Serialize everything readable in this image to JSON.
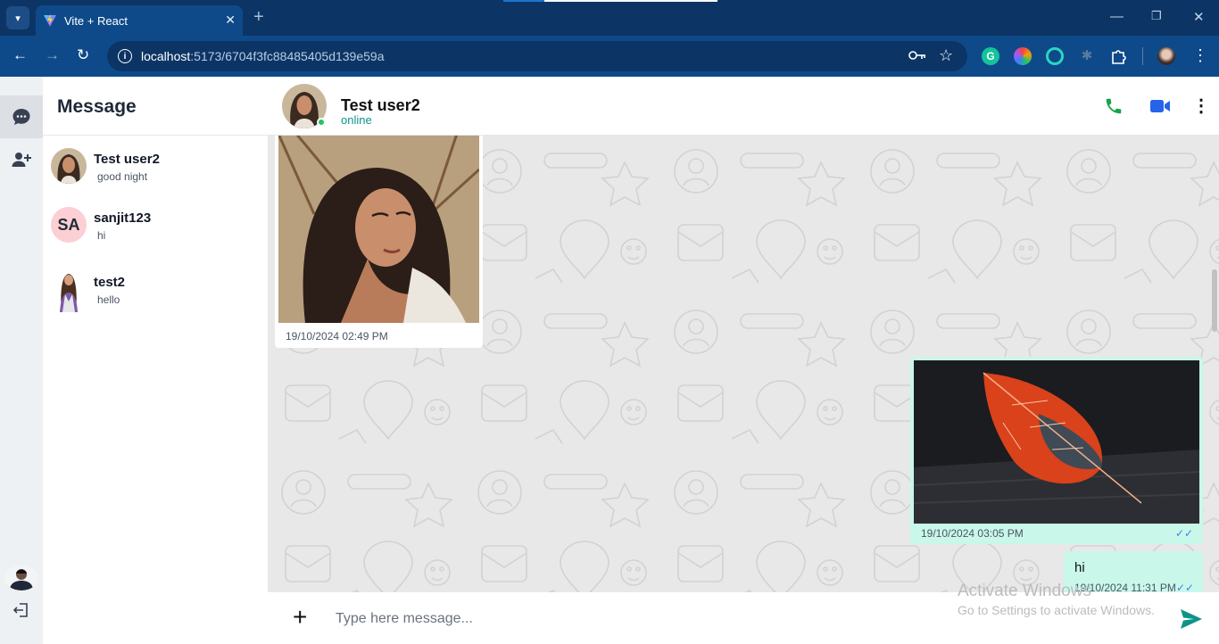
{
  "browser": {
    "tab_title": "Vite + React",
    "url_host": "localhost",
    "url_path": ":5173/6704f3fc88485405d139e59a"
  },
  "icons": {
    "tab_menu": "chevron-down-icon",
    "tab_close": "close-icon",
    "new_tab": "plus-icon",
    "back": "arrow-left-icon",
    "forward": "arrow-right-icon",
    "reload": "reload-icon",
    "site_info": "info-icon",
    "password": "key-icon",
    "bookmark": "star-icon",
    "minimize": "minimize-icon",
    "maximize": "restore-icon",
    "close_window": "close-icon"
  },
  "sidebar": {
    "title": "Message",
    "contacts": [
      {
        "name": "Test user2",
        "last_message": "good night",
        "avatar": "photo"
      },
      {
        "name": "sanjit123",
        "last_message": "hi",
        "avatar": "initials",
        "initials": "SA"
      },
      {
        "name": "test2",
        "last_message": "hello",
        "avatar": "photo"
      }
    ]
  },
  "chat": {
    "contact_name": "Test user2",
    "status": "online",
    "messages": [
      {
        "direction": "incoming",
        "type": "image",
        "image": "portrait-woman",
        "time": "19/10/2024 02:49 PM"
      },
      {
        "direction": "outgoing",
        "type": "image",
        "image": "red-leaf",
        "time": "19/10/2024 03:05 PM",
        "ticks": "✓✓"
      },
      {
        "direction": "outgoing",
        "type": "text",
        "text": "hi",
        "time": "19/10/2024 11:31 PM",
        "ticks": "✓✓"
      }
    ],
    "composer_placeholder": "Type here message...",
    "add_symbol": "+"
  },
  "watermark": {
    "line1": "Activate Windows",
    "line2": "Go to Settings to activate Windows."
  },
  "colors": {
    "chrome_dark": "#0c3566",
    "chrome": "#0e4a8a",
    "accent_teal": "#0d9488",
    "online": "#22c55e",
    "call_green": "#16a34a",
    "video_blue": "#2563eb",
    "outgoing_bubble": "#c9f7e9"
  }
}
